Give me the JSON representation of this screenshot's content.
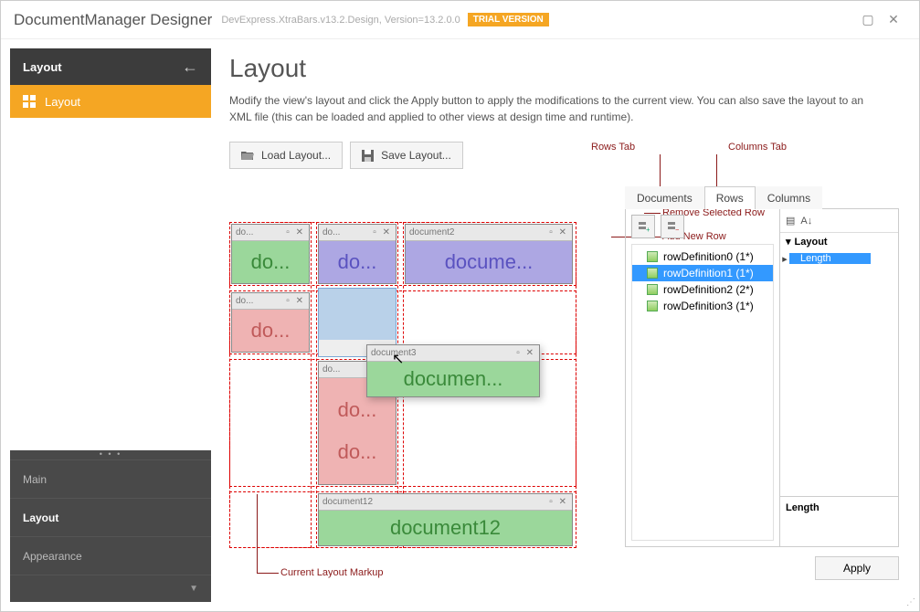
{
  "titlebar": {
    "title": "DocumentManager Designer",
    "subtitle": "DevExpress.XtraBars.v13.2.Design, Version=13.2.0.0",
    "trial": "TRIAL VERSION"
  },
  "sidebar": {
    "header": "Layout",
    "active_item": "Layout",
    "categories": [
      "Main",
      "Layout",
      "Appearance"
    ]
  },
  "page": {
    "title": "Layout",
    "desc": "Modify the view's layout and click the Apply button to apply the modifications to the current view. You can also save the layout to an XML file (this can be loaded and applied to other views at design time and runtime).",
    "load_btn": "Load Layout...",
    "save_btn": "Save Layout..."
  },
  "callouts": {
    "rows_tab": "Rows Tab",
    "columns_tab": "Columns Tab",
    "remove_row": "Remove Selected Row",
    "add_row": "Add New Row",
    "current_markup": "Current Layout Markup"
  },
  "tiles": {
    "d0": {
      "title": "do...",
      "body": "do..."
    },
    "d1": {
      "title": "do...",
      "body": "do..."
    },
    "d2": {
      "title": "document2",
      "body": "docume..."
    },
    "d3": {
      "title": "do...",
      "body": "do..."
    },
    "drag": {
      "title": "document3",
      "body": "documen..."
    },
    "d5": {
      "title": "do...",
      "body": "do..."
    },
    "d5b": {
      "body": "do..."
    },
    "d12": {
      "title": "document12",
      "body": "document12"
    }
  },
  "tabs": {
    "documents": "Documents",
    "rows": "Rows",
    "columns": "Columns"
  },
  "tree": {
    "items": [
      {
        "label": "rowDefinition0 (1*)"
      },
      {
        "label": "rowDefinition1 (1*)"
      },
      {
        "label": "rowDefinition2 (2*)"
      },
      {
        "label": "rowDefinition3 (1*)"
      }
    ]
  },
  "props": {
    "category": "Layout",
    "item": "Length",
    "desc_title": "Length"
  },
  "apply": "Apply"
}
